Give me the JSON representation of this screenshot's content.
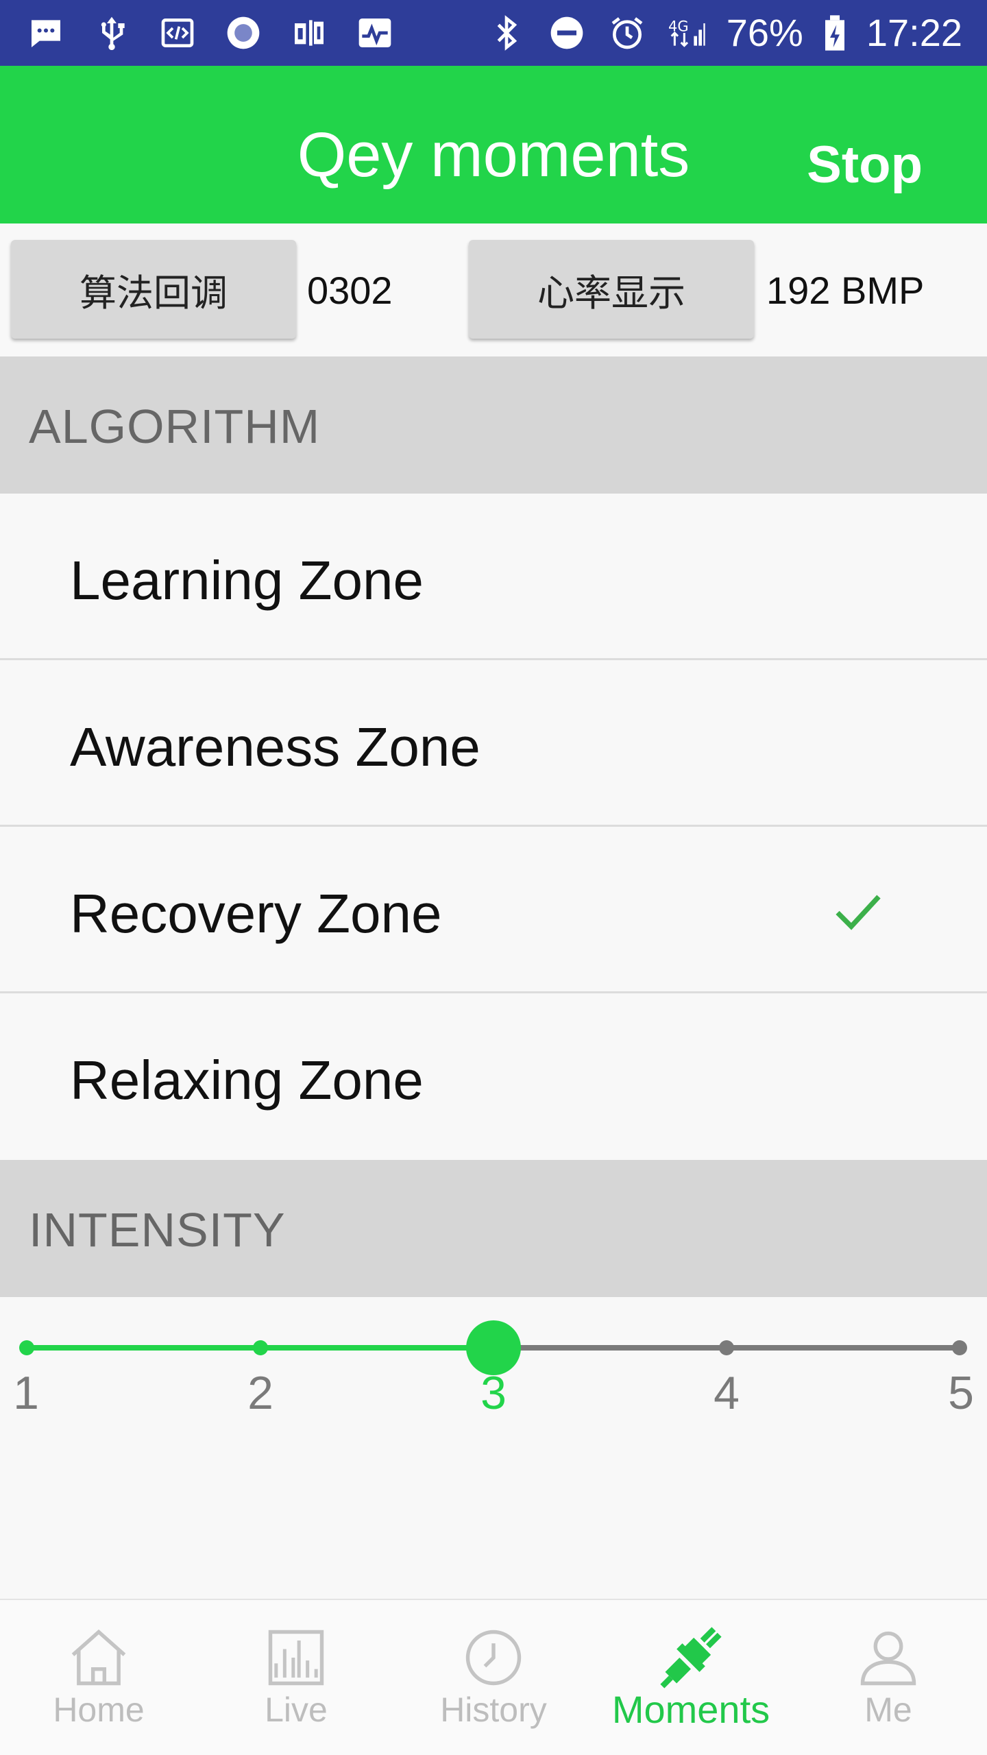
{
  "status_bar": {
    "icons_left": [
      "message-icon",
      "usb-icon",
      "code-icon",
      "record-icon",
      "app-icon",
      "pulse-icon"
    ],
    "icons_right": [
      "bluetooth-icon",
      "do-not-disturb-icon",
      "alarm-icon",
      "signal-icon"
    ],
    "battery": "76%",
    "time": "17:22"
  },
  "app_bar": {
    "title": "Qey moments",
    "stop_label": "Stop",
    "color": "#22d44a"
  },
  "controls": {
    "algorithm_callback_label": "算法回调",
    "algorithm_value": "0302",
    "heart_rate_label": "心率显示",
    "heart_rate_value": "192 BMP"
  },
  "algorithm": {
    "header": "ALGORITHM",
    "zones": [
      {
        "label": "Learning Zone",
        "selected": false
      },
      {
        "label": "Awareness Zone",
        "selected": false
      },
      {
        "label": "Recovery Zone",
        "selected": true
      },
      {
        "label": "Relaxing Zone",
        "selected": false
      }
    ]
  },
  "intensity": {
    "header": "INTENSITY",
    "ticks": [
      "1",
      "2",
      "3",
      "4",
      "5"
    ],
    "selected": 3
  },
  "bottom_nav": {
    "items": [
      {
        "label": "Home",
        "icon": "home-icon",
        "active": false
      },
      {
        "label": "Live",
        "icon": "live-chart-icon",
        "active": false
      },
      {
        "label": "History",
        "icon": "history-clock-icon",
        "active": false
      },
      {
        "label": "Moments",
        "icon": "plug-icon",
        "active": true
      },
      {
        "label": "Me",
        "icon": "person-icon",
        "active": false
      }
    ]
  }
}
